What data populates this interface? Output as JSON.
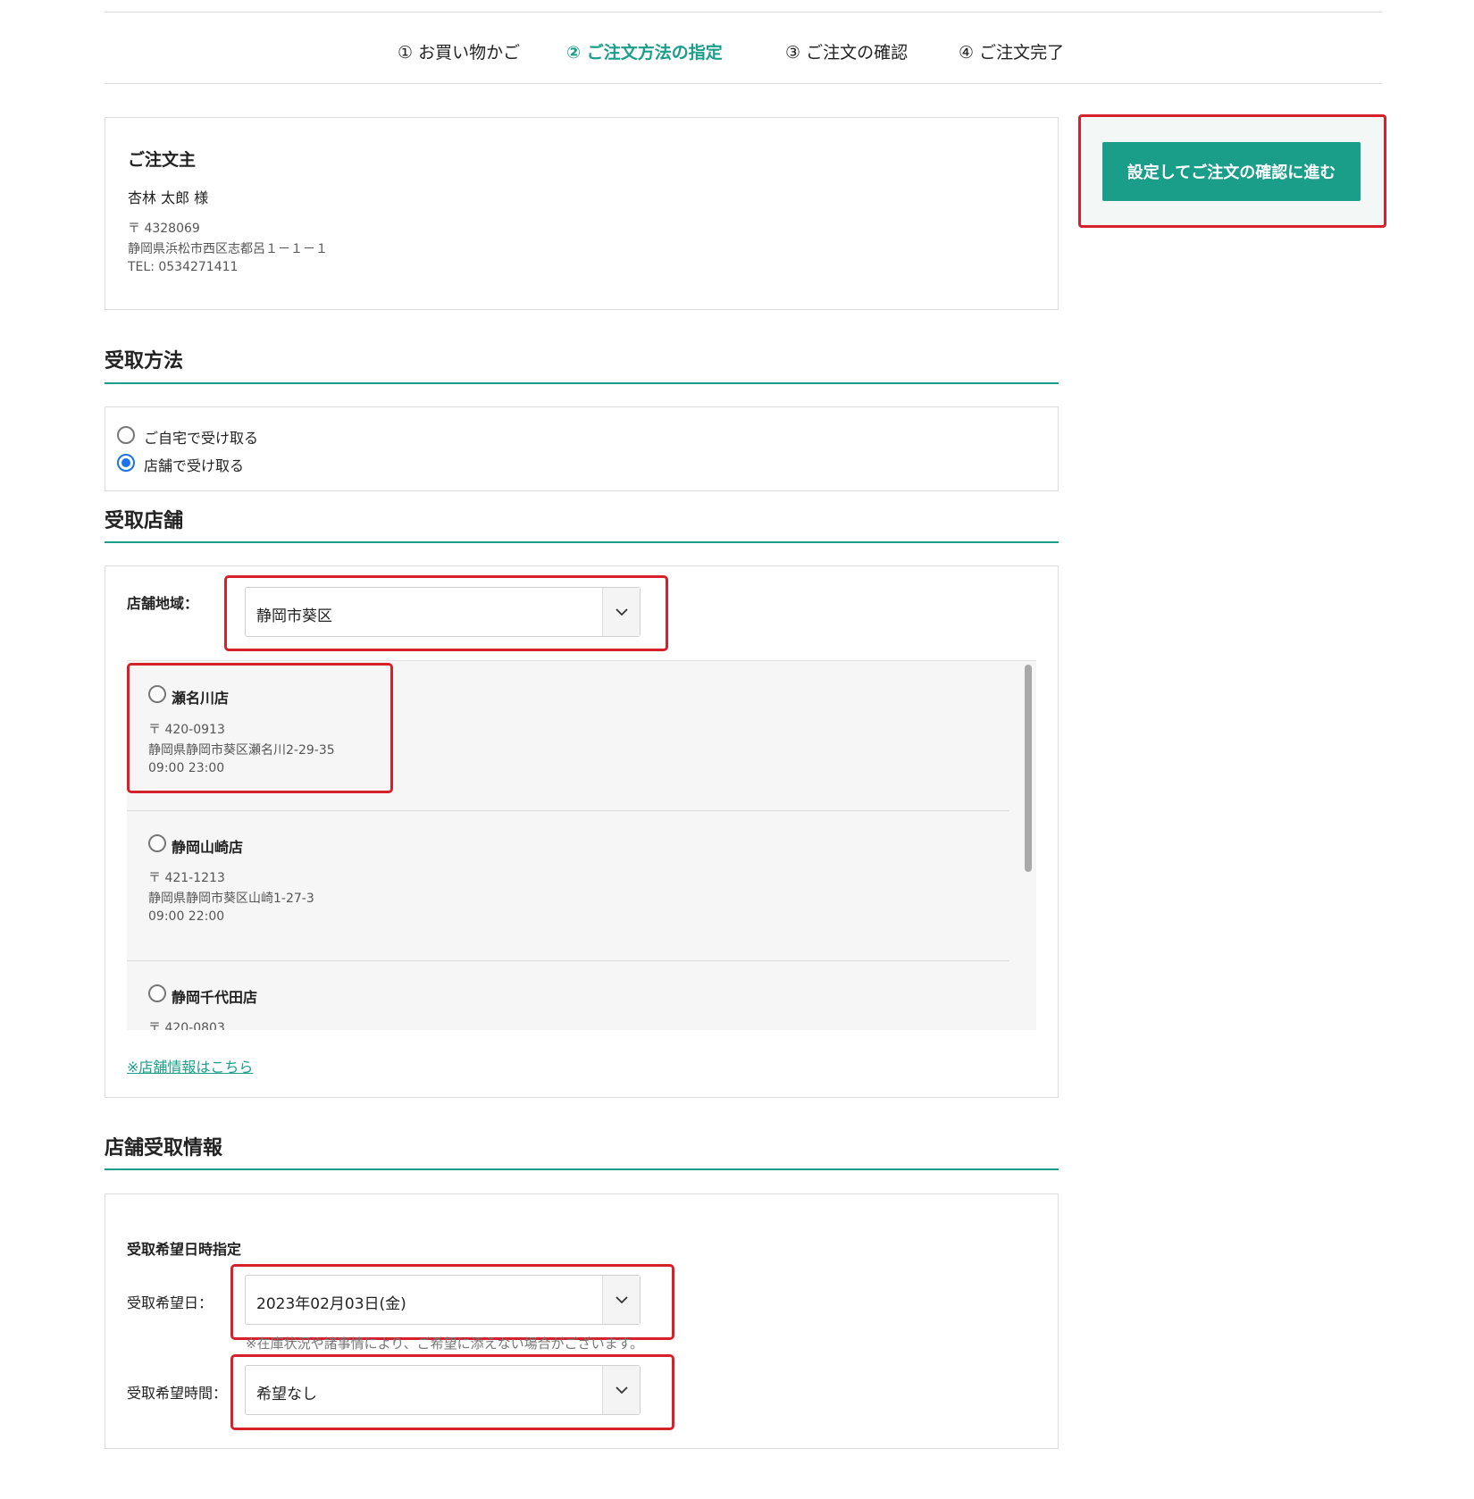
{
  "steps": [
    {
      "label": "① お買い物かご"
    },
    {
      "label": "② ご注文方法の指定"
    },
    {
      "label": "③ ご注文の確認"
    },
    {
      "label": "④ ご注文完了"
    }
  ],
  "orderer": {
    "title": "ご注文主",
    "name": "杏林 太郎 様",
    "postal": "〒 4328069",
    "address": "静岡県浜松市西区志都呂１－１－１",
    "tel": "TEL: 0534271411"
  },
  "cta": {
    "label": "設定してご注文の確認に進む"
  },
  "receive_method": {
    "title": "受取方法",
    "options": [
      {
        "label": "ご自宅で受け取る",
        "selected": false
      },
      {
        "label": "店舗で受け取る",
        "selected": true
      }
    ]
  },
  "store": {
    "title": "受取店舗",
    "region_label": "店舗地域：",
    "region_value": "静岡市葵区",
    "stores": [
      {
        "name": "瀬名川店",
        "postal": "〒 420-0913",
        "address": "静岡県静岡市葵区瀬名川2-29-35",
        "hours": "09:00 23:00"
      },
      {
        "name": "静岡山崎店",
        "postal": "〒 421-1213",
        "address": "静岡県静岡市葵区山崎1-27-3",
        "hours": "09:00 22:00"
      },
      {
        "name": "静岡千代田店",
        "postal": "〒 420-0803"
      }
    ],
    "info_link": "※店舗情報はこちら"
  },
  "pickup": {
    "title": "店舗受取情報",
    "subtitle": "受取希望日時指定",
    "date_label": "受取希望日：",
    "date_value": "2023年02月03日(金)",
    "note": "※在庫状況や諸事情により、ご希望に添えない場合がございます。",
    "time_label": "受取希望時間：",
    "time_value": "希望なし"
  },
  "colors": {
    "accent": "#1a9e8a",
    "highlight": "#d6202c",
    "radio_selected": "#1a73e8"
  }
}
